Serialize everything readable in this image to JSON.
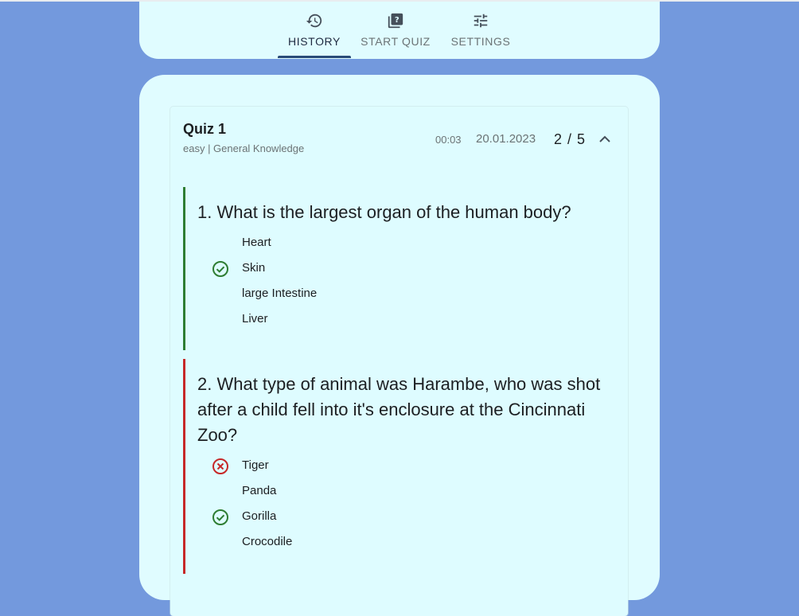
{
  "nav": {
    "tabs": [
      {
        "label": "HISTORY",
        "icon": "history-icon",
        "active": true
      },
      {
        "label": "START QUIZ",
        "icon": "quiz-icon",
        "active": false
      },
      {
        "label": "SETTINGS",
        "icon": "tune-icon",
        "active": false
      }
    ]
  },
  "quiz": {
    "title": "Quiz 1",
    "subtitle": "easy | General Knowledge",
    "time": "00:03",
    "date": "20.01.2023",
    "score": "2 / 5",
    "questions": [
      {
        "text": "1. What is the largest organ of the human body?",
        "status": "correct",
        "answers": [
          "Heart",
          "Skin",
          "large Intestine",
          "Liver"
        ],
        "correct_index": 1,
        "selected_index": 1
      },
      {
        "text": "2. What type of animal was Harambe, who was shot after a child fell into it's enclosure at the Cincinnati Zoo?",
        "status": "wrong",
        "answers": [
          "Tiger",
          "Panda",
          "Gorilla",
          "Crocodile"
        ],
        "correct_index": 2,
        "selected_index": 0
      }
    ]
  },
  "colors": {
    "background": "#7399dd",
    "card": "#e0fcff",
    "correct": "#2e7d32",
    "wrong": "#c62828",
    "tab_indicator": "#294a78"
  }
}
